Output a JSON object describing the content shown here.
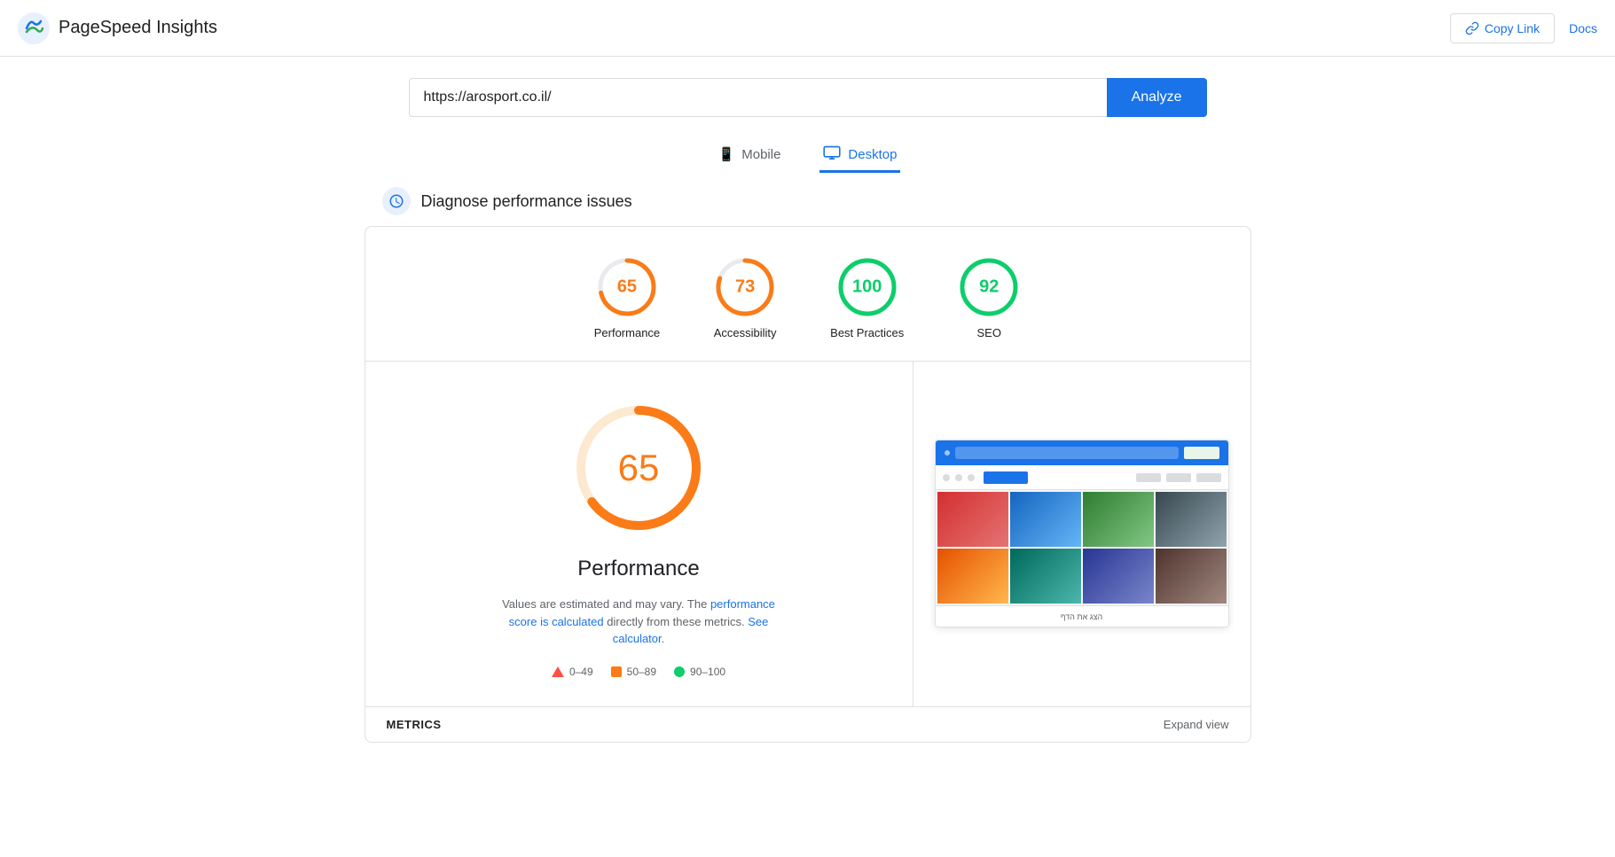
{
  "header": {
    "title": "PageSpeed Insights",
    "copy_link_label": "Copy Link",
    "docs_label": "Docs"
  },
  "url_bar": {
    "value": "https://arosport.co.il/",
    "placeholder": "Enter a web page URL",
    "analyze_label": "Analyze"
  },
  "tabs": [
    {
      "id": "mobile",
      "label": "Mobile",
      "icon": "📱",
      "active": false
    },
    {
      "id": "desktop",
      "label": "Desktop",
      "icon": "🖥",
      "active": true
    }
  ],
  "diagnose": {
    "title": "Diagnose performance issues"
  },
  "scores": [
    {
      "id": "performance",
      "value": 65,
      "label": "Performance",
      "color": "orange",
      "percent": 65
    },
    {
      "id": "accessibility",
      "value": 73,
      "label": "Accessibility",
      "color": "orange",
      "percent": 73
    },
    {
      "id": "best-practices",
      "value": 100,
      "label": "Best Practices",
      "color": "green",
      "percent": 100
    },
    {
      "id": "seo",
      "value": 92,
      "label": "SEO",
      "color": "green",
      "percent": 92
    }
  ],
  "performance_detail": {
    "score": 65,
    "title": "Performance",
    "description_static": "Values are estimated and may vary. The",
    "description_link1": "performance score is calculated",
    "description_mid": "directly from these metrics.",
    "description_link2": "See calculator.",
    "legend": [
      {
        "shape": "triangle",
        "range": "0–49",
        "color": "red"
      },
      {
        "shape": "square",
        "range": "50–89",
        "color": "orange"
      },
      {
        "shape": "circle",
        "range": "90–100",
        "color": "green"
      }
    ]
  },
  "bottom_bar": {
    "metrics_label": "METRICS",
    "expand_label": "Expand view"
  },
  "screenshot": {
    "footer_text": "הצג את הדף"
  }
}
